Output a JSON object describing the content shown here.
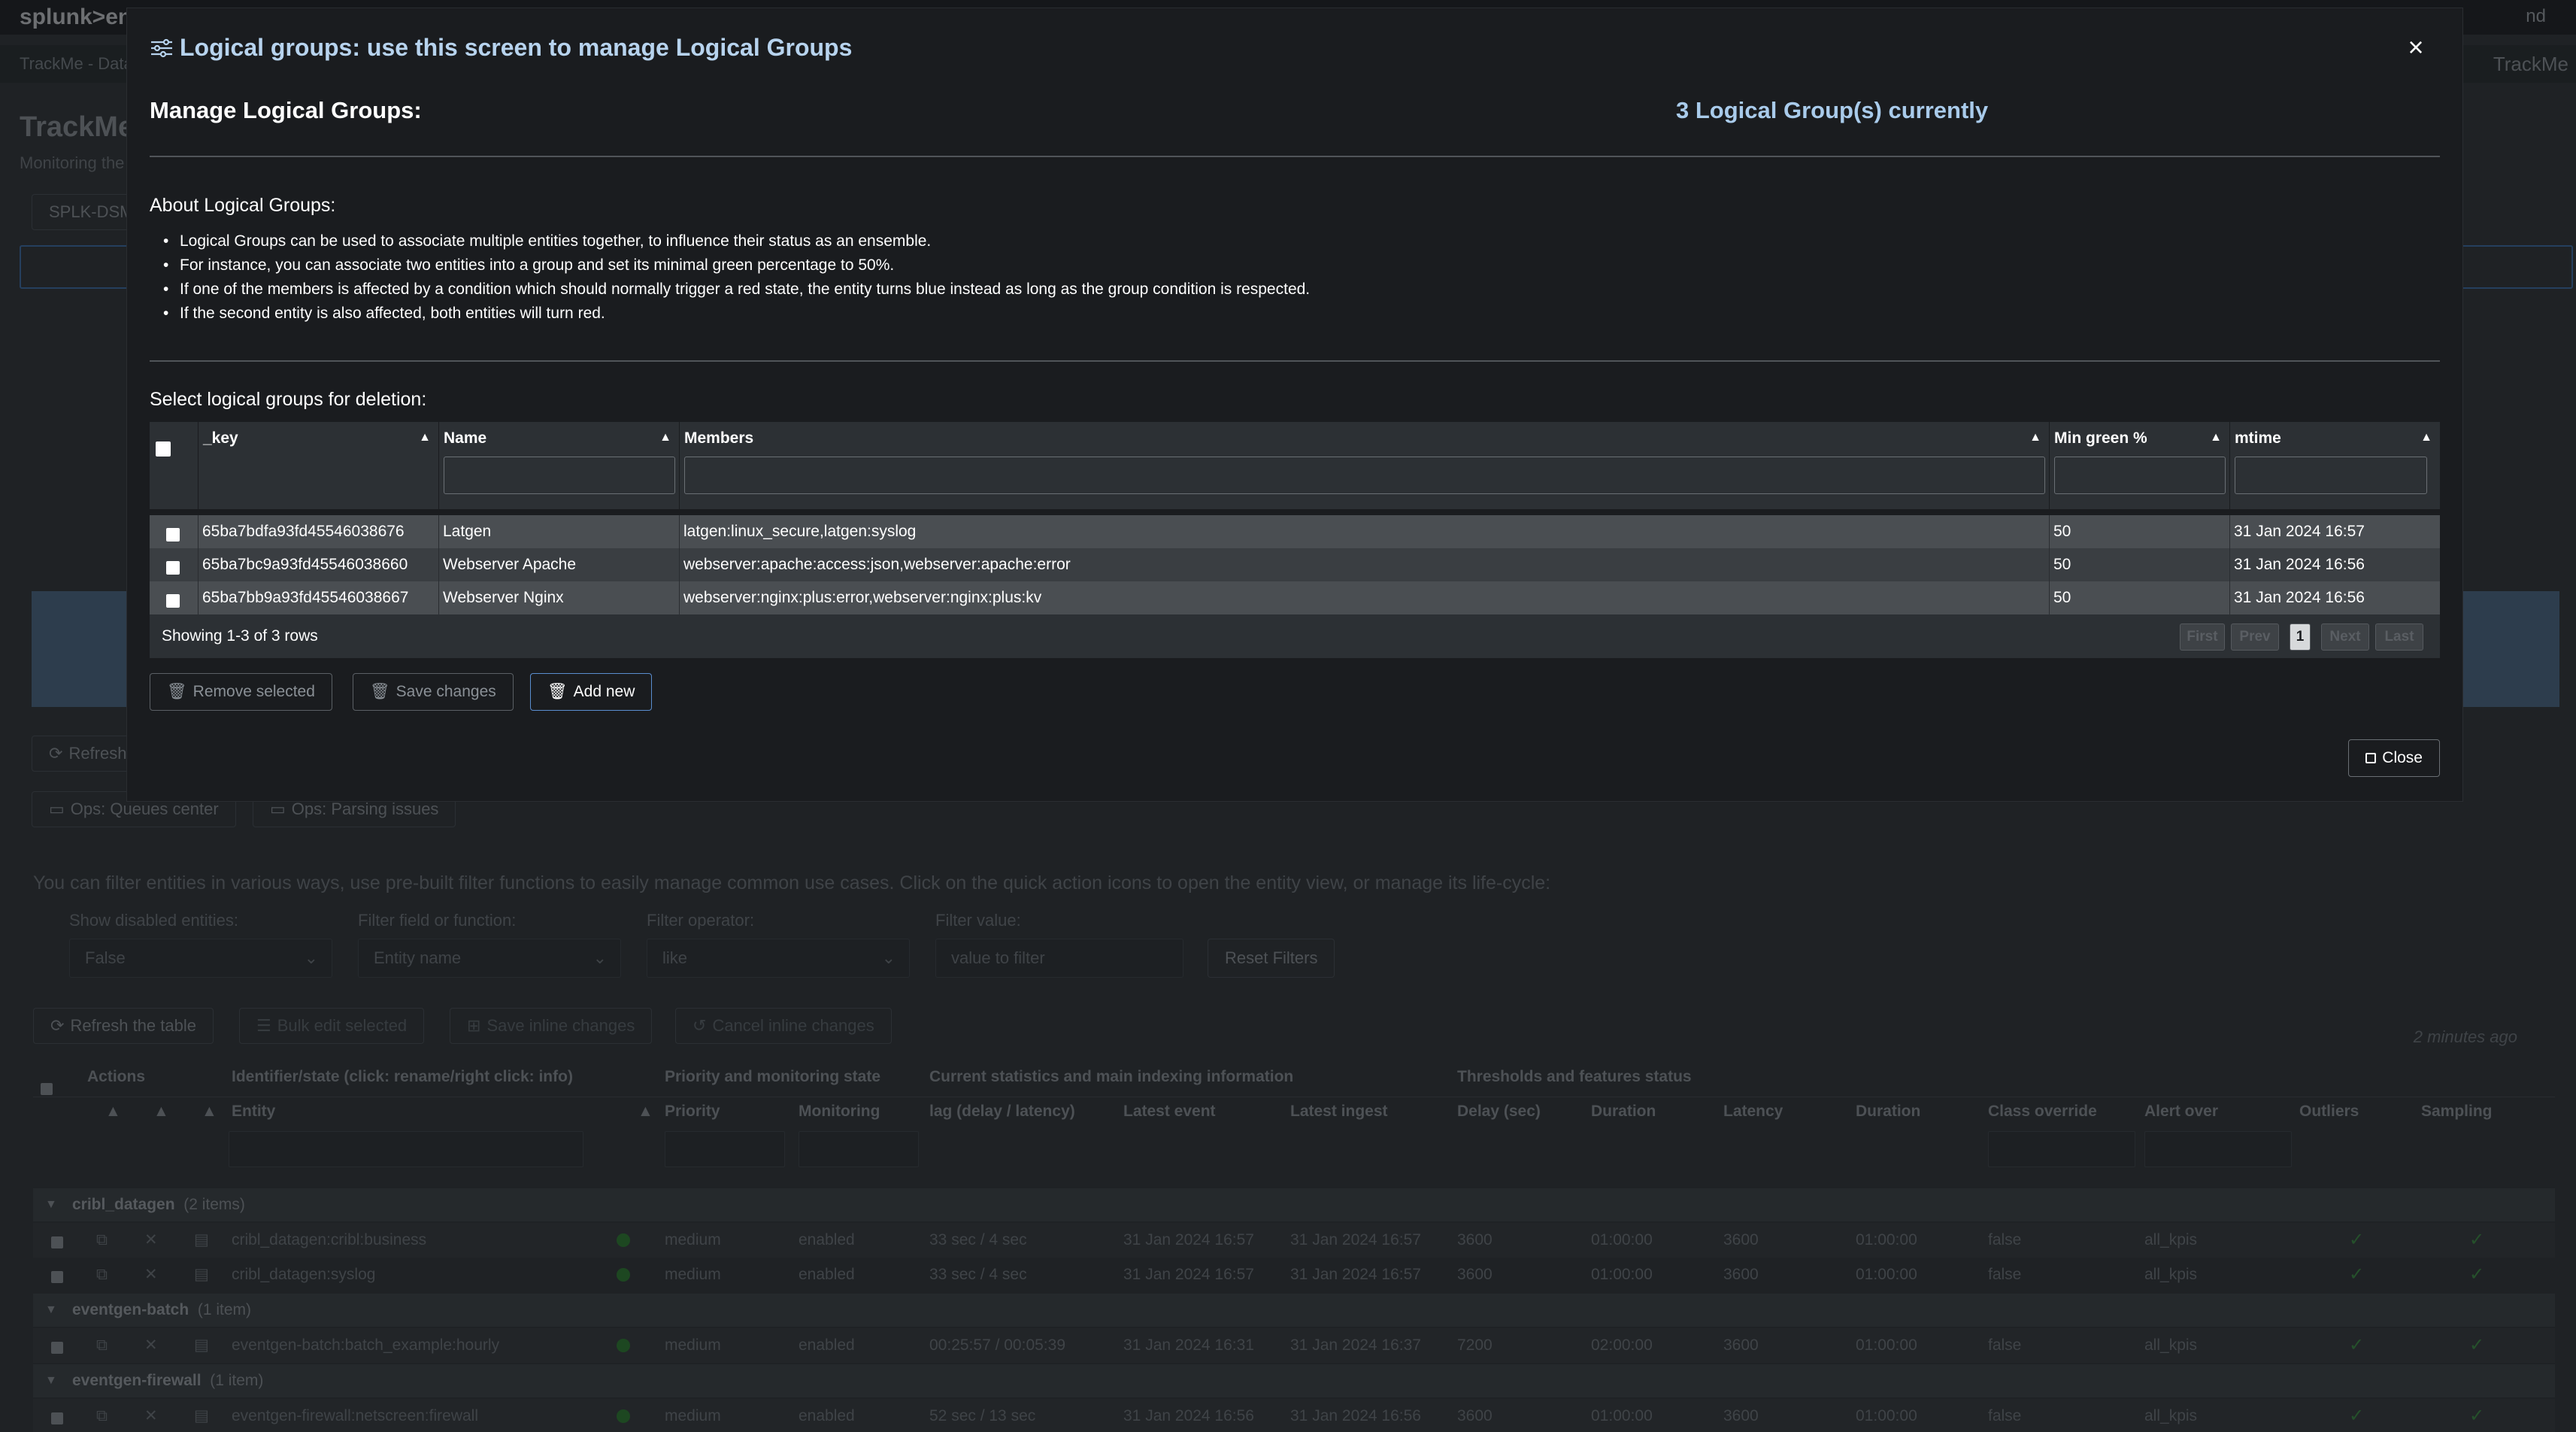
{
  "background": {
    "brand": "splunk>ent",
    "top_right": "nd",
    "breadcrumb": "TrackMe - Data",
    "app_name": "TrackMe",
    "page_title": "TrackMe",
    "page_subtitle": "Monitoring the",
    "tab_label": "SPLK-DSM",
    "buttons": {
      "refresh": "Refresh",
      "ops_queues": "Ops: Queues center",
      "ops_parsing": "Ops: Parsing issues",
      "refresh_table": "Refresh the table",
      "bulk_edit": "Bulk edit selected",
      "save_inline": "Save inline changes",
      "cancel_inline": "Cancel inline changes",
      "reset_filters": "Reset Filters"
    },
    "help_text": "You can filter entities in various ways, use pre-built filter functions to easily manage common use cases. Click on the quick action icons to open the entity view, or manage its life-cycle:",
    "filters": [
      {
        "label": "Show disabled entities:",
        "value": "False"
      },
      {
        "label": "Filter field or function:",
        "value": "Entity name"
      },
      {
        "label": "Filter operator:",
        "value": "like"
      },
      {
        "label": "Filter value:",
        "placeholder": "value to filter"
      }
    ],
    "updated": "2 minutes ago",
    "table": {
      "group_headers": [
        "Actions",
        "Identifier/state (click: rename/right click: info)",
        "Priority and monitoring state",
        "Current statistics and main indexing information",
        "Thresholds and features status"
      ],
      "columns": [
        "Entity",
        "Priority",
        "Monitoring",
        "lag (delay / latency)",
        "Latest event",
        "Latest ingest",
        "Delay (sec)",
        "Duration",
        "Latency",
        "Duration",
        "Class override",
        "Alert over",
        "Outliers",
        "Sampling"
      ],
      "groups": [
        {
          "name": "cribl_datagen",
          "count": "(2 items)",
          "rows": [
            [
              "cribl_datagen:cribl:business",
              "medium",
              "enabled",
              "33 sec / 4 sec",
              "31 Jan 2024 16:57",
              "31 Jan 2024 16:57",
              "3600",
              "01:00:00",
              "3600",
              "01:00:00",
              "false",
              "all_kpis"
            ],
            [
              "cribl_datagen:syslog",
              "medium",
              "enabled",
              "33 sec / 4 sec",
              "31 Jan 2024 16:57",
              "31 Jan 2024 16:57",
              "3600",
              "01:00:00",
              "3600",
              "01:00:00",
              "false",
              "all_kpis"
            ]
          ]
        },
        {
          "name": "eventgen-batch",
          "count": "(1 item)",
          "rows": [
            [
              "eventgen-batch:batch_example:hourly",
              "medium",
              "enabled",
              "00:25:57 / 00:05:39",
              "31 Jan 2024 16:31",
              "31 Jan 2024 16:37",
              "7200",
              "02:00:00",
              "3600",
              "01:00:00",
              "false",
              "all_kpis"
            ]
          ]
        },
        {
          "name": "eventgen-firewall",
          "count": "(1 item)",
          "rows": [
            [
              "eventgen-firewall:netscreen:firewall",
              "medium",
              "enabled",
              "52 sec / 13 sec",
              "31 Jan 2024 16:56",
              "31 Jan 2024 16:56",
              "3600",
              "01:00:00",
              "3600",
              "01:00:00",
              "false",
              "all_kpis"
            ]
          ]
        }
      ]
    }
  },
  "modal": {
    "title": "Logical groups: use this screen to manage Logical Groups",
    "heading": "Manage Logical Groups:",
    "count_text": "3 Logical Group(s) currently",
    "about_title": "About Logical Groups:",
    "about_items": [
      "Logical Groups can be used to associate multiple entities together, to influence their status as an ensemble.",
      "For instance, you can associate two entities into a group and set its minimal green percentage to 50%.",
      "If one of the members is affected by a condition which should normally trigger a red state, the entity turns blue instead as long as the group condition is respected.",
      "If the second entity is also affected, both entities will turn red."
    ],
    "select_label": "Select logical groups for deletion:",
    "table": {
      "columns": [
        "_key",
        "Name",
        "Members",
        "Min green %",
        "mtime"
      ],
      "rows": [
        [
          "65ba7bdfa93fd45546038676",
          "Latgen",
          "latgen:linux_secure,latgen:syslog",
          "50",
          "31 Jan 2024 16:57"
        ],
        [
          "65ba7bc9a93fd45546038660",
          "Webserver Apache",
          "webserver:apache:access:json,webserver:apache:error",
          "50",
          "31 Jan 2024 16:56"
        ],
        [
          "65ba7bb9a93fd45546038667",
          "Webserver Nginx",
          "webserver:nginx:plus:error,webserver:nginx:plus:kv",
          "50",
          "31 Jan 2024 16:56"
        ]
      ],
      "showing": "Showing 1-3 of 3 rows",
      "pager": {
        "first": "First",
        "prev": "Prev",
        "page": "1",
        "next": "Next",
        "last": "Last"
      }
    },
    "buttons": {
      "remove": "Remove selected",
      "save": "Save changes",
      "add": "Add new",
      "close": "Close"
    },
    "close_icon": "×"
  }
}
